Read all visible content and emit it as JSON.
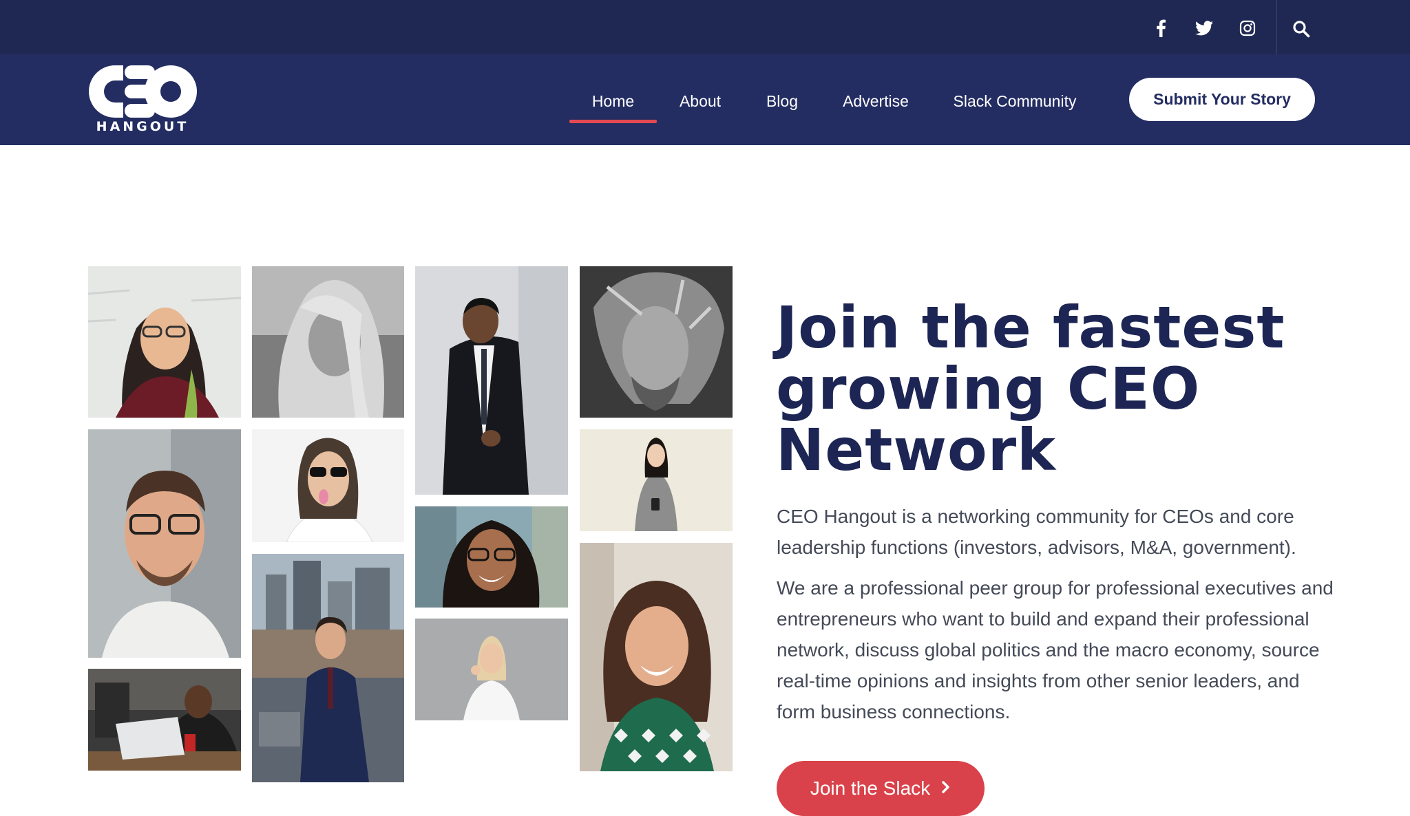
{
  "topbar": {
    "social_icons": [
      "facebook-icon",
      "twitter-icon",
      "instagram-icon"
    ],
    "search_icon": "search-icon"
  },
  "logo": {
    "word": "CEO",
    "sub": "HANGOUT"
  },
  "nav": {
    "items": [
      {
        "label": "Home",
        "active": true
      },
      {
        "label": "About",
        "active": false
      },
      {
        "label": "Blog",
        "active": false
      },
      {
        "label": "Advertise",
        "active": false
      },
      {
        "label": "Slack Community",
        "active": false
      }
    ],
    "submit_label": "Submit Your Story"
  },
  "hero": {
    "title": "Join the fastest growing CEO Network",
    "paragraph_1": "CEO Hangout is a networking community for CEOs and core leadership functions (investors, advisors, M&A, government).",
    "paragraph_2": "We are a professional peer group for professional executives and entrepreneurs who want to build and expand their professional network, discuss global politics and the macro economy, source real-time opinions and insights from other senior leaders, and form business connections.",
    "cta_label": "Join the Slack"
  },
  "colors": {
    "topbar": "#1f2852",
    "navbar": "#232d62",
    "accent": "#e14a52",
    "heading": "#1c2553",
    "cta": "#d9424a"
  }
}
